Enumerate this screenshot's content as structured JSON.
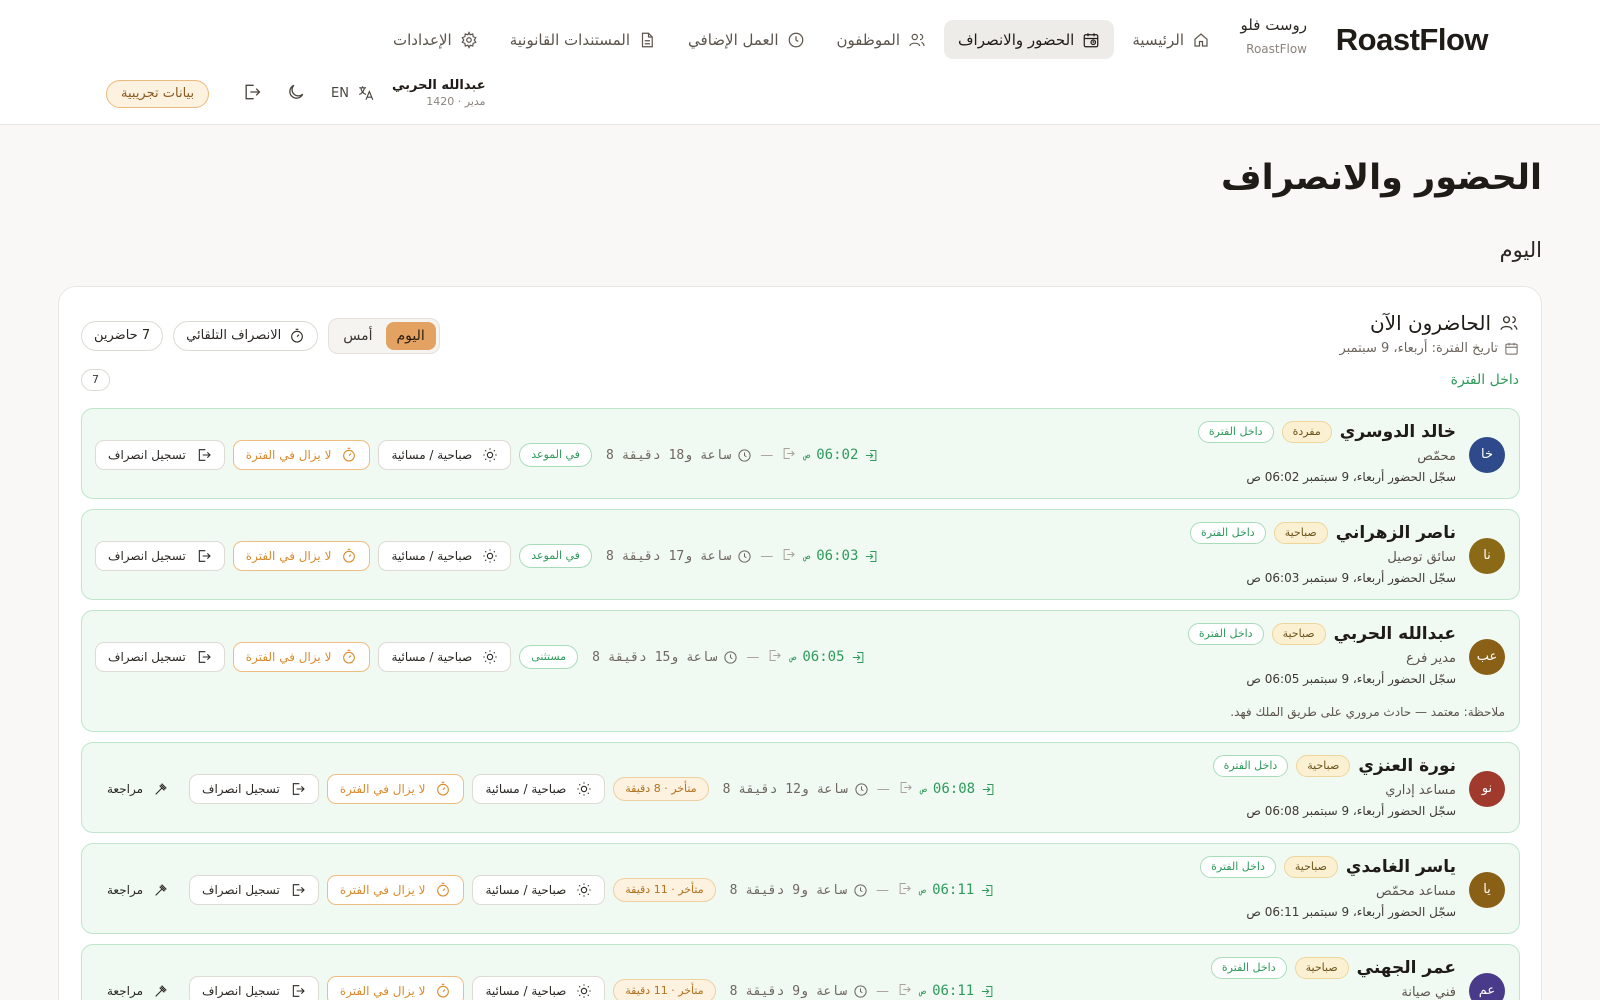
{
  "brand": {
    "logo": "RoastFlow",
    "name_ar": "روست فلو",
    "name_en": "RoastFlow"
  },
  "nav": {
    "items": [
      {
        "label": "الرئيسية",
        "icon": "home-icon",
        "active": false
      },
      {
        "label": "الحضور والانصراف",
        "icon": "calendar-clock-icon",
        "active": true
      },
      {
        "label": "الموظفون",
        "icon": "users-icon",
        "active": false
      },
      {
        "label": "العمل الإضافي",
        "icon": "clock-icon",
        "active": false
      },
      {
        "label": "المستندات القانونية",
        "icon": "document-icon",
        "active": false
      },
      {
        "label": "الإعدادات",
        "icon": "gear-icon",
        "active": false
      }
    ]
  },
  "user": {
    "name": "عبدالله الحربي",
    "meta": "مدير · 1420",
    "lang": "EN",
    "demo_badge": "بيانات تجريبية"
  },
  "page": {
    "title": "الحضور والانصراف",
    "section": "اليوم"
  },
  "present": {
    "title": "الحاضرون الآن",
    "date": "تاريخ الفترة: أربعاء، 9 سبتمبر",
    "tabs": {
      "today": "اليوم",
      "yesterday": "أمس"
    },
    "auto_checkout": "الانصراف التلقائي",
    "count_label": "7 حاضرين",
    "group_label": "داخل الفترة",
    "group_count": "7"
  },
  "labels": {
    "checkout": "تسجيل انصراف",
    "still_in": "لا يزال في الفترة",
    "shift_type": "صباحية / مسائية",
    "review": "مراجعة",
    "in_shift": "داخل الفترة",
    "dash": "—",
    "am": "ص"
  },
  "employees": [
    {
      "initials": "خا",
      "avatar_color": "#2e4a8a",
      "name": "خالد الدوسري",
      "shift": "مفردة",
      "role": "محمّص",
      "in_at": "سجّل الحضور أربعاء، 9 سبتمبر 06:02 ص",
      "in_time": "06:02",
      "duration": "8 ساعة و18 دقيقة",
      "status": "في الموعد",
      "status_kind": "green",
      "review": false,
      "note": ""
    },
    {
      "initials": "نا",
      "avatar_color": "#8a6a16",
      "name": "ناصر الزهراني",
      "shift": "صباحية",
      "role": "سائق توصيل",
      "in_at": "سجّل الحضور أربعاء، 9 سبتمبر 06:03 ص",
      "in_time": "06:03",
      "duration": "8 ساعة و17 دقيقة",
      "status": "في الموعد",
      "status_kind": "green",
      "review": false,
      "note": ""
    },
    {
      "initials": "عب",
      "avatar_color": "#8a6016",
      "name": "عبدالله الحربي",
      "shift": "صباحية",
      "role": "مدير فرع",
      "in_at": "سجّل الحضور أربعاء، 9 سبتمبر 06:05 ص",
      "in_time": "06:05",
      "duration": "8 ساعة و15 دقيقة",
      "status": "مستثنى",
      "status_kind": "green",
      "review": false,
      "note": "ملاحظة: معتمد — حادث مروري على طريق الملك فهد."
    },
    {
      "initials": "نو",
      "avatar_color": "#a03a2c",
      "name": "نورة العنزي",
      "shift": "صباحية",
      "role": "مساعد إداري",
      "in_at": "سجّل الحضور أربعاء، 9 سبتمبر 06:08 ص",
      "in_time": "06:08",
      "duration": "8 ساعة و12 دقيقة",
      "status": "متأخر · 8 دقيقة",
      "status_kind": "amber",
      "review": true,
      "note": ""
    },
    {
      "initials": "يا",
      "avatar_color": "#8a6016",
      "name": "ياسر الغامدي",
      "shift": "صباحية",
      "role": "مساعد محمّص",
      "in_at": "سجّل الحضور أربعاء، 9 سبتمبر 06:11 ص",
      "in_time": "06:11",
      "duration": "8 ساعة و9 دقيقة",
      "status": "متأخر · 11 دقيقة",
      "status_kind": "amber",
      "review": true,
      "note": ""
    },
    {
      "initials": "عم",
      "avatar_color": "#4a3a8a",
      "name": "عمر الجهني",
      "shift": "صباحية",
      "role": "فني صيانة",
      "in_at": "",
      "in_time": "06:11",
      "duration": "8 ساعة و9 دقيقة",
      "status": "متأخر · 11 دقيقة",
      "status_kind": "amber",
      "review": true,
      "note": ""
    }
  ]
}
